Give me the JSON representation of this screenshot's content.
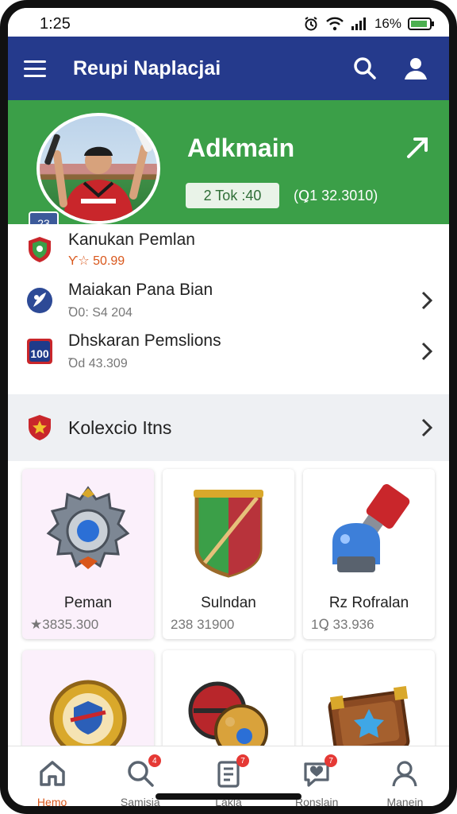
{
  "status_bar": {
    "time": "1:25",
    "battery": "16%"
  },
  "app_bar": {
    "title": "Reupi Naplacjai"
  },
  "profile": {
    "name": "Adkmain",
    "level": "23",
    "chip": "2 Tok :40",
    "value": "(Ꝗ1 32.3010)"
  },
  "list": [
    {
      "title": "Kanukan Pemlan",
      "sub": "Ƴ☆ 50.99",
      "sub_color": "#d9571b",
      "icon": "shield-icon",
      "has_chevron": false
    },
    {
      "title": "Maiakan Pana Bian",
      "sub": "Ꝺ0: S4 204",
      "sub_color": "#777777",
      "icon": "emblem-icon",
      "has_chevron": true
    },
    {
      "title": "Dhskaran Pemslions",
      "sub": "Ꝺd 43.309",
      "sub_color": "#777777",
      "icon": "badge-100-icon",
      "has_chevron": true
    }
  ],
  "collection": {
    "title": "Kolexcio Itns"
  },
  "items": [
    {
      "name": "Peman",
      "price": "★3835.300",
      "art": "gear-medal-icon"
    },
    {
      "name": "Sulndan",
      "price": "238 31900",
      "art": "shield-item-icon"
    },
    {
      "name": "Rz  Rofralan",
      "price": "1Ꝗ 33.936",
      "art": "potion-device-icon"
    },
    {
      "name": "",
      "price": "",
      "art": "gold-badge-icon"
    },
    {
      "name": "",
      "price": "",
      "art": "balls-icon"
    },
    {
      "name": "",
      "price": "",
      "art": "chest-icon"
    }
  ],
  "bottom_nav": [
    {
      "label": "Hemo",
      "icon": "home-icon",
      "badge": "",
      "active": true
    },
    {
      "label": "Samisia",
      "icon": "search-icon",
      "badge": "4",
      "active": false
    },
    {
      "label": "Lakla",
      "icon": "list-icon",
      "badge": "7",
      "active": false
    },
    {
      "label": "Ronslain",
      "icon": "chat-icon",
      "badge": "7",
      "active": false
    },
    {
      "label": "Manein",
      "icon": "profile-icon",
      "badge": "",
      "active": false
    }
  ],
  "colors": {
    "app_bar": "#253a8c",
    "banner": "#3b9f48",
    "active_nav": "#d9571b"
  }
}
